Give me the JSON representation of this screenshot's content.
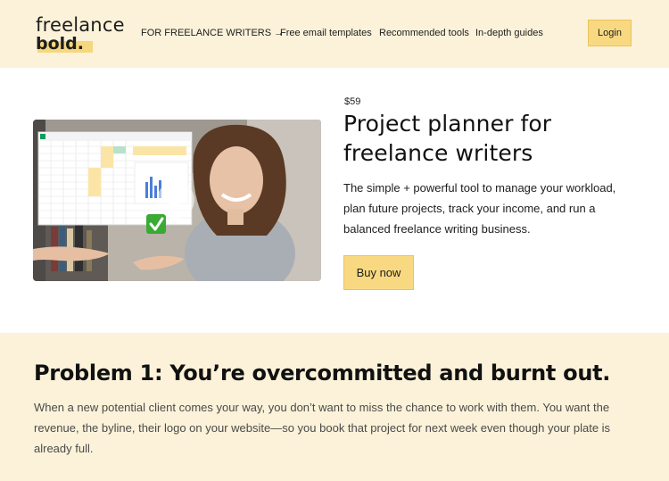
{
  "header": {
    "logo_line1": "freelance",
    "logo_line2": "bold.",
    "nav": [
      {
        "label": "FOR FREELANCE WRITERS →"
      },
      {
        "label": "Free email templates"
      },
      {
        "label": "Recommended tools"
      },
      {
        "label": "In-depth guides"
      }
    ],
    "login_label": "Login"
  },
  "hero": {
    "price": "$59",
    "title": "Project planner for freelance writers",
    "description": "The simple + powerful tool to manage your workload, plan future projects, track your income, and run a balanced freelance writing business.",
    "buy_label": "Buy now",
    "video": {
      "play_icon": "play-icon",
      "check_icon": "checkmark-icon"
    }
  },
  "problem": {
    "title": "Problem 1: You’re overcommitted and burnt out.",
    "text": "When a new potential client comes your way, you don’t want to miss the chance to work with them. You want the revenue, the byline, their logo on your website—so you book that project for next week even though your plate is already full."
  },
  "colors": {
    "header_bg": "#fbf2d9",
    "accent": "#f8d982",
    "accent_border": "#ecc25e",
    "section_bg": "#fbf2d9"
  }
}
